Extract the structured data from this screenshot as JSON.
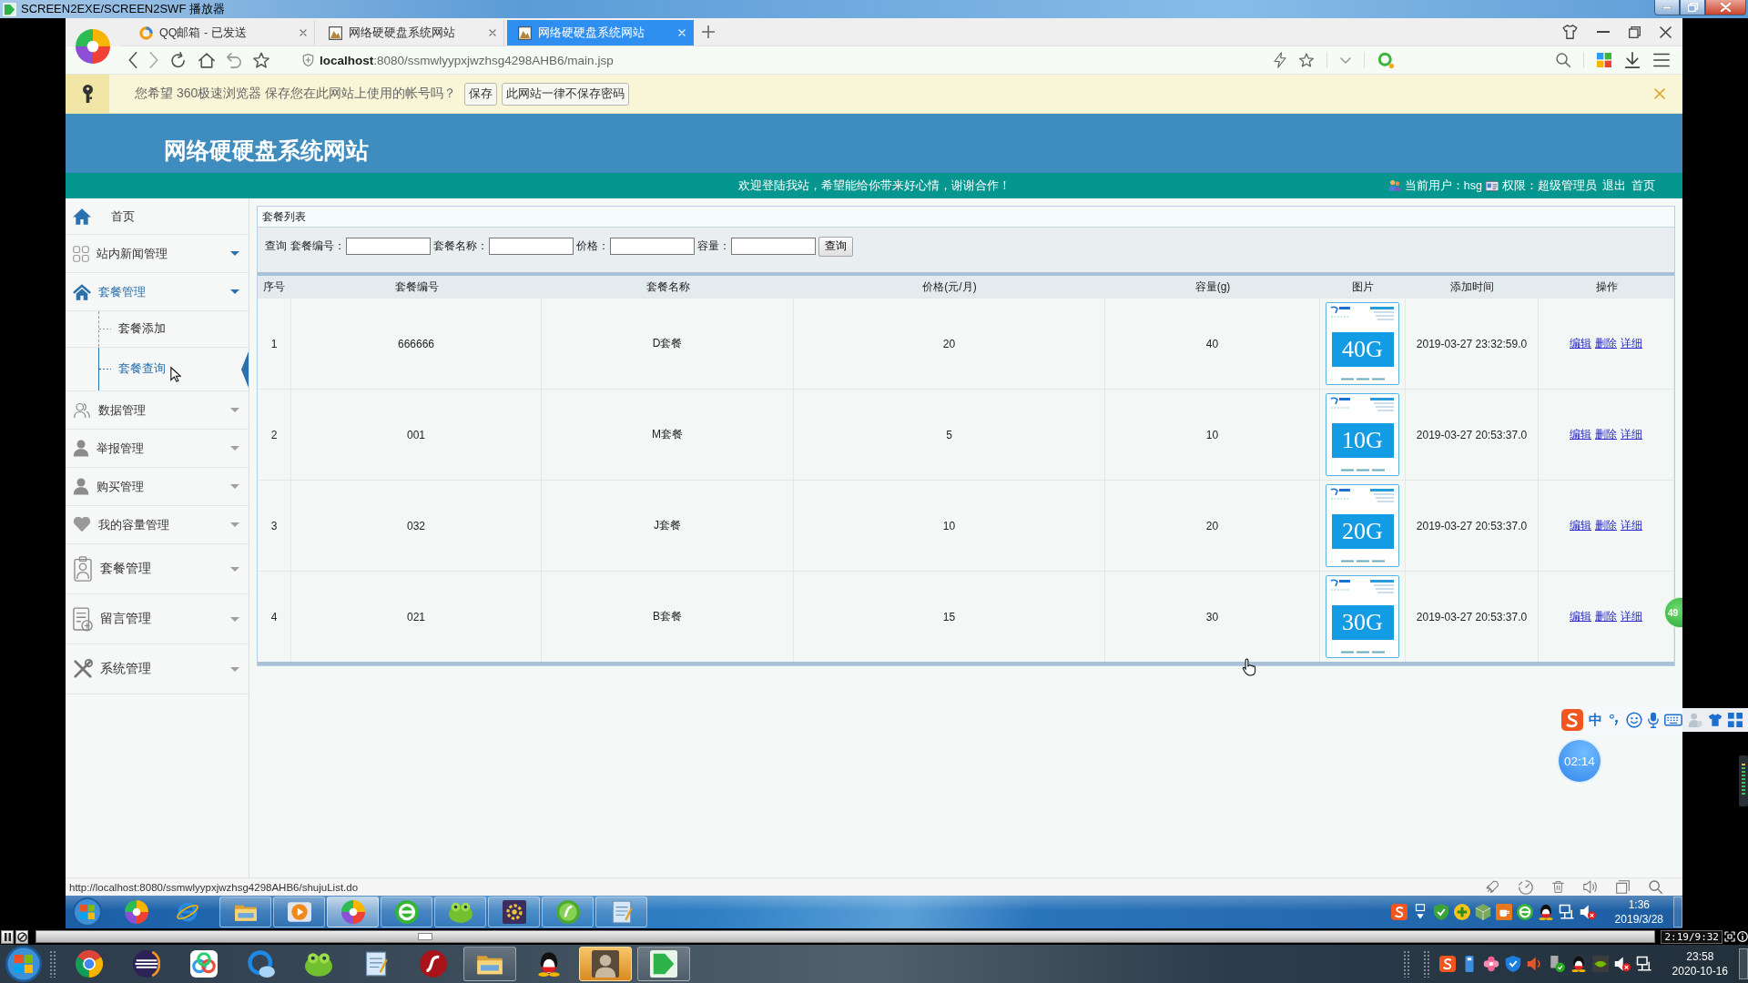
{
  "player_window": {
    "title": "SCREEN2EXE/SCREEN2SWF 播放器"
  },
  "browser": {
    "tabs": [
      {
        "label": "QQ邮箱 - 已发送",
        "selected": false
      },
      {
        "label": "网络硬硬盘系统网站",
        "selected": false
      },
      {
        "label": "网络硬硬盘系统网站",
        "selected": true
      }
    ],
    "url": "**localhost**:8080/ssmwlyypxjwzhsg4298AHB6/main.jsp",
    "password_prompt": {
      "message": "您希望 360极速浏览器 保存您在此网站上使用的帐号吗？",
      "buttons": [
        "保存",
        "此网站一律不保存密码"
      ]
    }
  },
  "site": {
    "title": "网络硬硬盘系统网站",
    "welcome": "欢迎登陆我站，希望能给你带来好心情，谢谢合作！",
    "user_bar": [
      {
        "kind": "user",
        "text": "当前用户：hsg"
      },
      {
        "kind": "role",
        "text": "权限：超级管理员"
      },
      {
        "kind": "link",
        "text": "退出"
      },
      {
        "kind": "link",
        "text": "首页"
      }
    ],
    "sidebar": [
      {
        "label": "首页",
        "kind": "link",
        "expanded": false
      },
      {
        "label": "站内新闻管理",
        "kind": "menu",
        "expanded": false
      },
      {
        "label": "套餐管理",
        "kind": "menu",
        "expanded": true,
        "children": [
          {
            "label": "套餐添加",
            "selected": false
          },
          {
            "label": "套餐查询",
            "selected": true
          }
        ]
      },
      {
        "label": "数据管理",
        "kind": "menu_muted",
        "expanded": false
      },
      {
        "label": "举报管理",
        "kind": "menu_muted",
        "expanded": false
      },
      {
        "label": "购买管理",
        "kind": "menu_muted",
        "expanded": false
      },
      {
        "label": "我的容量管理",
        "kind": "menu_muted",
        "expanded": false
      },
      {
        "label": "套餐管理",
        "kind": "menu_large",
        "expanded": false
      },
      {
        "label": "留言管理",
        "kind": "menu_large",
        "expanded": false
      },
      {
        "label": "系统管理",
        "kind": "menu_large",
        "expanded": false
      }
    ],
    "panel": {
      "title": "套餐列表",
      "search_label": "查询",
      "fields": [
        {
          "label": "套餐编号："
        },
        {
          "label": "套餐名称："
        },
        {
          "label": "价格："
        },
        {
          "label": "容量："
        }
      ],
      "search_button": "查询"
    },
    "table": {
      "columns": [
        "序号",
        "套餐编号",
        "套餐名称",
        "价格(元/月)",
        "容量(g)",
        "图片",
        "添加时间",
        "操作"
      ],
      "rows": [
        {
          "cells": [
            "1",
            "666666",
            "D套餐",
            "20",
            "40"
          ],
          "image_label": "40G",
          "added": "2019-03-27 23:32:59.0",
          "actions": [
            "编辑",
            "删除",
            "详细"
          ]
        },
        {
          "cells": [
            "2",
            "001",
            "M套餐",
            "5",
            "10"
          ],
          "image_label": "10G",
          "added": "2019-03-27 20:53:37.0",
          "actions": [
            "编辑",
            "删除",
            "详细"
          ]
        },
        {
          "cells": [
            "3",
            "032",
            "J套餐",
            "10",
            "20"
          ],
          "image_label": "20G",
          "added": "2019-03-27 20:53:37.0",
          "actions": [
            "编辑",
            "删除",
            "详细"
          ]
        },
        {
          "cells": [
            "4",
            "021",
            "B套餐",
            "15",
            "30"
          ],
          "image_label": "30G",
          "added": "2019-03-27 20:53:37.0",
          "actions": [
            "编辑",
            "删除",
            "详细"
          ]
        }
      ]
    },
    "side_badge": "49"
  },
  "status_url": "http://localhost:8080/ssmwlyypxjwzhsg4298AHB6/shujuList.do",
  "inner_taskbar": {
    "windows": [
      {
        "selected": false
      },
      {
        "selected": false
      },
      {
        "selected": true
      },
      {
        "selected": false
      },
      {
        "selected": false
      },
      {
        "selected": false
      },
      {
        "selected": false
      },
      {
        "selected": false
      }
    ],
    "time": "1:36",
    "date": "2019/3/28"
  },
  "ime_toolbar": {
    "mode": "中"
  },
  "timer": "02:14",
  "player_controls": {
    "position": "2:19/9:32",
    "level": 0.24
  },
  "host_taskbar": {
    "windows": [
      {
        "selected": false
      },
      {
        "selected": true
      },
      {
        "selected": false
      }
    ],
    "time": "23:58",
    "date": "2020-10-16"
  }
}
